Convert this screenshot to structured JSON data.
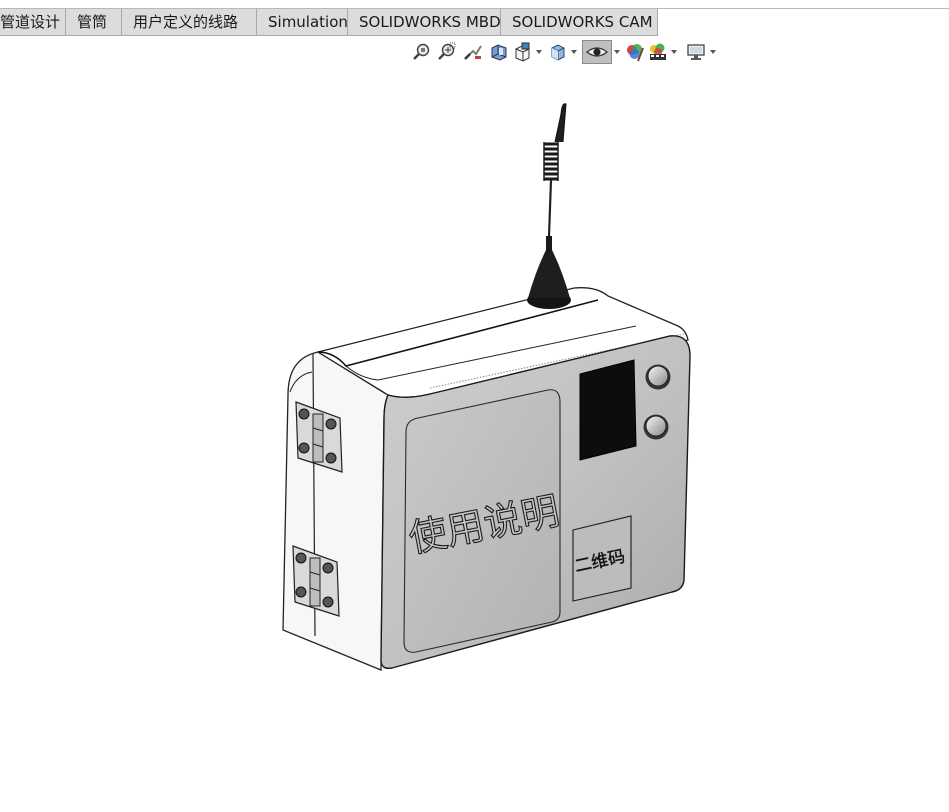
{
  "ribbon": {
    "tabs": [
      {
        "label": "管道设计"
      },
      {
        "label": "管筒"
      },
      {
        "label": "用户定义的线路"
      },
      {
        "label": "Simulation"
      },
      {
        "label": "SOLIDWORKS MBD"
      },
      {
        "label": "SOLIDWORKS CAM"
      }
    ]
  },
  "view_toolbar": {
    "icons": [
      "zoom-to-fit-icon",
      "zoom-to-area-icon",
      "previous-view-icon",
      "section-view-icon",
      "view-orientation-icon",
      "display-style-icon",
      "hide-show-items-icon",
      "edit-appearance-icon",
      "apply-scene-icon",
      "view-settings-icon"
    ]
  },
  "model": {
    "front_label": "使用说明",
    "qr_label": "二维码"
  }
}
